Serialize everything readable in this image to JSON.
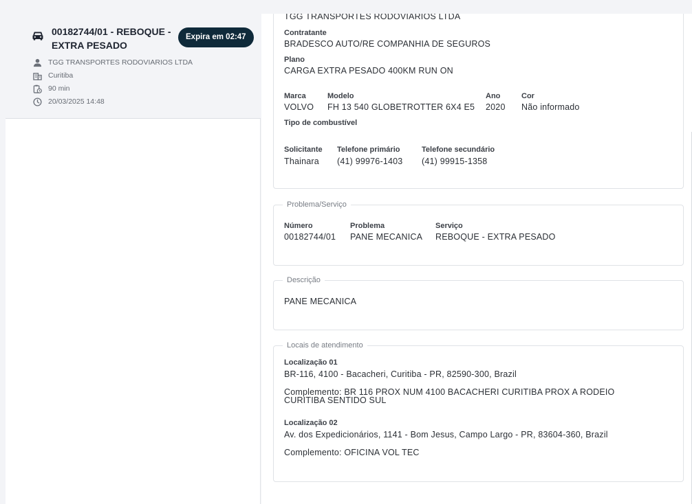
{
  "ticket": {
    "title": "00182744/01 - REBOQUE - EXTRA PESADO",
    "badge": "Expira em 02:47",
    "company": "TGG TRANSPORTES RODOVIARIOS LTDA",
    "city": "Curitiba",
    "duration": "90 min",
    "datetime": "20/03/2025 14:48"
  },
  "details": {
    "company_top": "TGG TRANSPORTES RODOVIARIOS LTDA",
    "contratante_label": "Contratante",
    "contratante": "BRADESCO AUTO/RE COMPANHIA DE SEGUROS",
    "plano_label": "Plano",
    "plano": "CARGA EXTRA PESADO 400KM RUN ON",
    "marca_label": "Marca",
    "marca": "VOLVO",
    "modelo_label": "Modelo",
    "modelo": "FH 13 540 GLOBETROTTER 6X4 E5",
    "ano_label": "Ano",
    "ano": "2020",
    "cor_label": "Cor",
    "cor": "Não informado",
    "combustivel_label": "Tipo de combustível",
    "solicitante_label": "Solicitante",
    "solicitante": "Thainara",
    "tel1_label": "Telefone primário",
    "tel1": "(41) 99976-1403",
    "tel2_label": "Telefone secundário",
    "tel2": "(41) 99915-1358"
  },
  "problema": {
    "legend": "Problema/Serviço",
    "numero_label": "Número",
    "numero": "00182744/01",
    "problema_label": "Problema",
    "problema": "PANE MECANICA",
    "servico_label": "Serviço",
    "servico": "REBOQUE - EXTRA PESADO"
  },
  "descricao": {
    "legend": "Descrição",
    "text": "PANE MECANICA"
  },
  "locais": {
    "legend": "Locais de atendimento",
    "loc1_label": "Localização 01",
    "loc1_address": "BR-116, 4100 - Bacacheri, Curitiba - PR, 82590-300, Brazil",
    "loc1_complement": "Complemento: BR 116 PROX NUM 4100 BACACHERI CURITIBA PROX A RODEIO CURITIBA SENTIDO SUL",
    "loc2_label": "Localização 02",
    "loc2_address": "Av. dos Expedicionários, 1141 - Bom Jesus, Campo Largo - PR, 83604-360, Brazil",
    "loc2_complement": "Complemento: OFICINA VOL TEC"
  },
  "icons": {
    "ticket": "truck-icon",
    "company": "person-icon",
    "city": "building-icon",
    "duration": "timer-clipboard-icon",
    "datetime": "clock-icon"
  },
  "colors": {
    "badge_bg": "#0f2a3a",
    "card_bg": "#f3f4f7",
    "border": "#dfe2e6"
  }
}
